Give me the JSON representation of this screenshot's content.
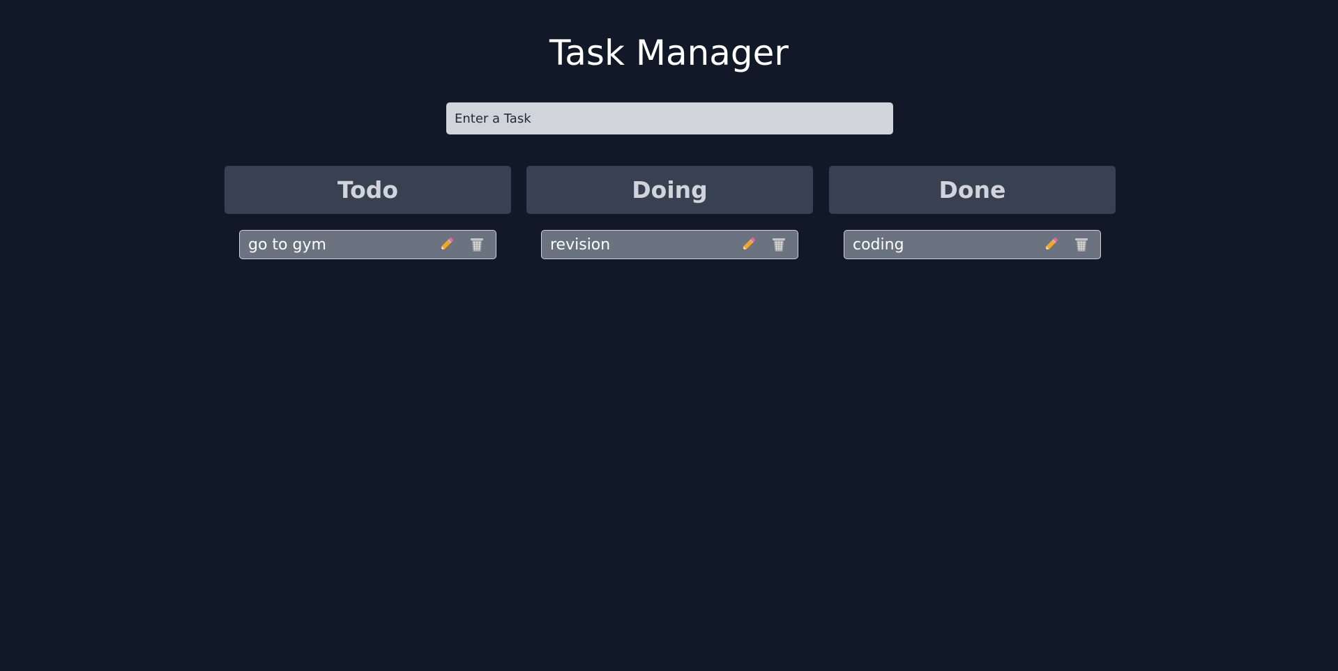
{
  "app": {
    "title": "Task Manager"
  },
  "input": {
    "placeholder": "Enter a Task",
    "value": ""
  },
  "columns": [
    {
      "label": "Todo",
      "tasks": [
        {
          "text": "go to gym"
        }
      ]
    },
    {
      "label": "Doing",
      "tasks": [
        {
          "text": "revision"
        }
      ]
    },
    {
      "label": "Done",
      "tasks": [
        {
          "text": "coding"
        }
      ]
    }
  ],
  "icons": {
    "edit": "pencil-icon",
    "delete": "trash-icon"
  },
  "colors": {
    "background": "#111827",
    "header_bg": "#374151",
    "card_bg": "#6b7280",
    "input_bg": "#d1d5db"
  }
}
